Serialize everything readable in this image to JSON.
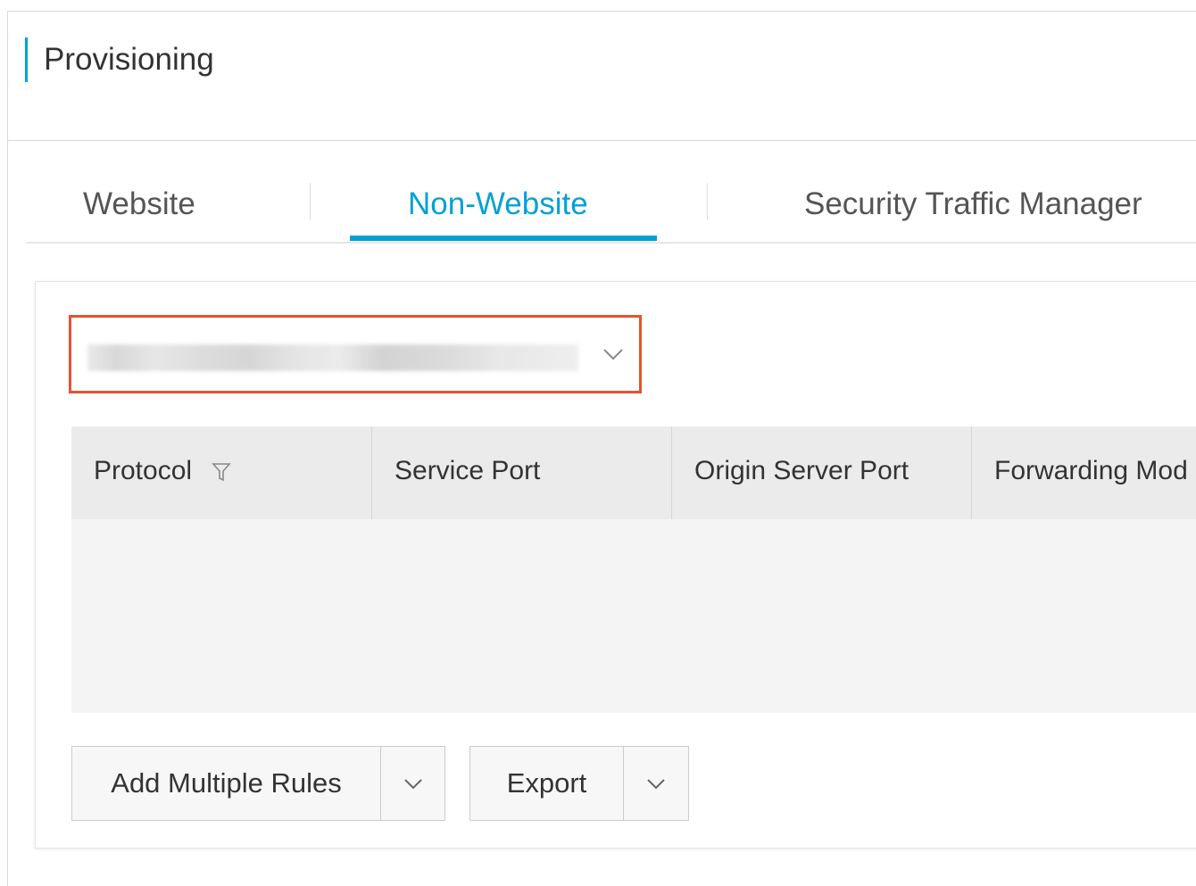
{
  "header": {
    "title": "Provisioning"
  },
  "tabs": [
    {
      "label": "Website",
      "active": false
    },
    {
      "label": "Non-Website",
      "active": true
    },
    {
      "label": "Security Traffic Manager",
      "active": false
    }
  ],
  "instance_select": {
    "value_obscured": true,
    "icon": "chevron-down-icon"
  },
  "table": {
    "columns": [
      {
        "label": "Protocol",
        "filterable": true
      },
      {
        "label": "Service Port",
        "filterable": false
      },
      {
        "label": "Origin Server Port",
        "filterable": false
      },
      {
        "label": "Forwarding Mod",
        "filterable": false
      }
    ],
    "rows": []
  },
  "actions": {
    "add_multiple_rules": "Add Multiple Rules",
    "export": "Export"
  },
  "colors": {
    "accent": "#00a1d6",
    "highlight_border": "#e8512f",
    "table_header_bg": "#ebebeb",
    "table_body_bg": "#f4f4f4"
  }
}
